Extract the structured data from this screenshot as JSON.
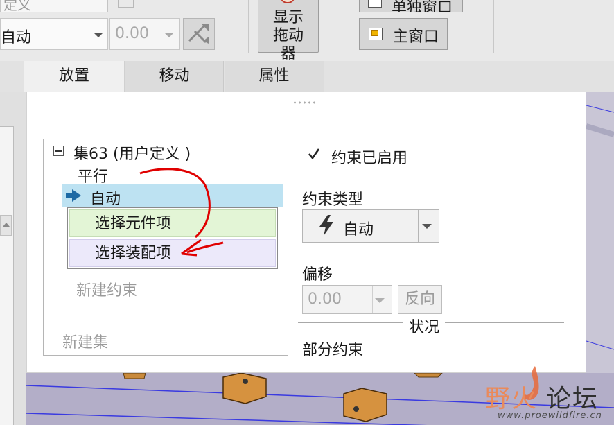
{
  "ribbon": {
    "cut_button_label": "定义",
    "placement_mode_value": "自动",
    "placement_offset_value": "0.00",
    "show_dragger_label": "显示拖动器",
    "sub_window_label": "单独窗口",
    "main_window_label": "主窗口"
  },
  "tabs": [
    {
      "label": "放置",
      "active": true
    },
    {
      "label": "移动",
      "active": false
    },
    {
      "label": "属性",
      "active": false
    }
  ],
  "tree": {
    "set_label": "集63 (用户定义 )",
    "constraint_label": "平行",
    "selected_item": "自动",
    "reference_items": [
      "选择元件项",
      "选择装配项"
    ],
    "new_constraint_label": "新建约束",
    "new_set_label": "新建集"
  },
  "constraint": {
    "enabled_label": "约束已启用",
    "enabled_checked": true,
    "type_heading": "约束类型",
    "type_value": "自动",
    "offset_heading": "偏移",
    "offset_value": "0.00",
    "flip_label": "反向",
    "status_heading": "状况",
    "status_value": "部分约束"
  },
  "watermark": {
    "brand_part1": "野火",
    "brand_part2": "论坛",
    "url": "www.proewildfire.cn"
  },
  "colors": {
    "selected_row": "#bde2f2",
    "component_ref": "#e3f5d6",
    "assembly_ref": "#ece9fa",
    "annotation": "#e00000",
    "bolt_icon": "#333333",
    "watermark_orange": "#ea8a5a"
  },
  "icons": {
    "auto_row": "arrow-right-icon",
    "constraint_type": "lightning-bolt-icon",
    "tree_toggle": "collapse-minus-icon"
  }
}
